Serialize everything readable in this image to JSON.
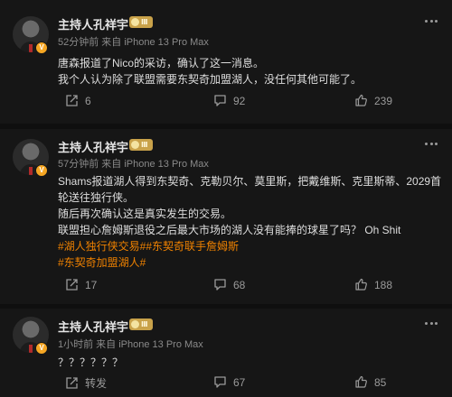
{
  "posts": [
    {
      "username": "主持人孔祥宇",
      "meta": "52分钟前 来自 iPhone 13 Pro Max",
      "lines": [
        "唐森报道了Nico的采访，确认了这一消息。",
        "我个人认为除了联盟需要东契奇加盟湖人，没任何其他可能了。"
      ],
      "repost": "6",
      "comments": "92",
      "likes": "239"
    },
    {
      "username": "主持人孔祥宇",
      "meta": "57分钟前 来自 iPhone 13 Pro Max",
      "lines": [
        "Shams报道湖人得到东契奇、克勒贝尔、莫里斯，把戴维斯、克里斯蒂、2029首",
        "轮送往独行侠。",
        "随后再次确认这是真实发生的交易。",
        "联盟担心詹姆斯退役之后最大市场的湖人没有能捧的球星了吗？ Oh Shit"
      ],
      "hashtags": [
        "#湖人独行侠交易##东契奇联手詹姆斯",
        "#东契奇加盟湖人#"
      ],
      "repost": "17",
      "comments": "68",
      "likes": "188"
    },
    {
      "username": "主持人孔祥宇",
      "meta": "1小时前 来自 iPhone 13 Pro Max",
      "lines": [
        "？？？？？？"
      ],
      "repost": "转发",
      "comments": "67",
      "likes": "85"
    }
  ],
  "icons": {
    "repost": "repost-icon",
    "comment": "comment-icon",
    "like": "thumbs-up-icon",
    "more": "more-dots-icon",
    "verified": "verified-badge-icon",
    "level": "level-badge-icon"
  },
  "colors": {
    "background": "#0f0f0f",
    "card": "#161616",
    "hashtag": "#f08200",
    "verified": "#f5a623",
    "level_badge": "#c9a24a"
  }
}
